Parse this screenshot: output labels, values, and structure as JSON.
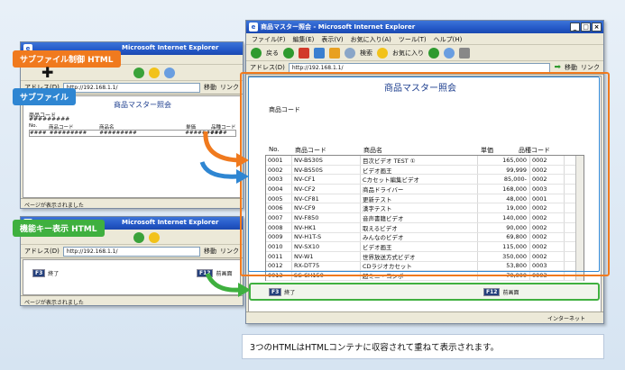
{
  "window": {
    "title": "商品マスター照会 - Microsoft Internet Explorer",
    "menus": [
      "ファイル(F)",
      "編集(E)",
      "表示(V)",
      "お気に入り(A)",
      "ツール(T)",
      "ヘルプ(H)"
    ],
    "toolbar": {
      "back": "戻る",
      "search": "検索",
      "favorites": "お気に入り"
    },
    "address_label": "アドレス(D)",
    "address_value": "http://192.168.1.1/",
    "go_label": "移動",
    "links_label": "リンク",
    "status_zone": "インターネット"
  },
  "page": {
    "heading": "商品マスター照会",
    "field_label": "商品コード",
    "columns": [
      "No.",
      "商品コード",
      "商品名",
      "単価",
      "品種コード"
    ],
    "rows": [
      [
        "0001",
        "NV-BS30S",
        "目次ビデオ TEST ①",
        "165,000",
        "0002"
      ],
      [
        "0002",
        "NV-BS50S",
        "ビデオ画王",
        "99,999",
        "0002"
      ],
      [
        "0003",
        "NV-CF1",
        "Cカセット編集ビデオ",
        "85,000-",
        "0002"
      ],
      [
        "0004",
        "NV-CF2",
        "商品ドライバー",
        "168,000",
        "0003"
      ],
      [
        "0005",
        "NV-CF81",
        "更新テスト",
        "48,000",
        "0001"
      ],
      [
        "0006",
        "NV-CF9",
        "漢字テスト",
        "19,000",
        "0002"
      ],
      [
        "0007",
        "NV-F850",
        "音声書籍ビデオ",
        "140,000",
        "0002"
      ],
      [
        "0008",
        "NV-HK1",
        "取えるビデオ",
        "90,000",
        "0002"
      ],
      [
        "0009",
        "NV-H1T-S",
        "みんなのビデオ",
        "69,800",
        "0002"
      ],
      [
        "0010",
        "NV-SX10",
        "ビデオ画王",
        "115,000",
        "0002"
      ],
      [
        "0011",
        "NV-W1",
        "世界放送方式ビデオ",
        "350,000",
        "0002"
      ],
      [
        "0012",
        "RX-DT75",
        "CDラジオカセット",
        "53,800",
        "0003"
      ],
      [
        "0013",
        "SC-CH150",
        "超ミニ・コンポ",
        "70,000",
        "0003"
      ]
    ]
  },
  "function_keys": [
    {
      "key": "F3",
      "label": "終了"
    },
    {
      "key": "F12",
      "label": "前画面"
    }
  ],
  "callouts": {
    "sub_control": "サブファイル制御 HTML",
    "subfile": "サブファイル",
    "fkey_html": "機能キー表示 HTML"
  },
  "small_windows": {
    "title": "Microsoft Internet Explorer",
    "address_label": "アドレス(D)",
    "address_value": "http://192.168.1.1/",
    "go_label": "移動",
    "links_label": "リンク",
    "status_done": "ページが表示されました",
    "sub_label": "商品コード",
    "sub_value": "#########",
    "sub_cols": [
      "No.",
      "商品コード",
      "商品名",
      "単価",
      "品種コード"
    ],
    "sub_row": [
      "####",
      "#########",
      "#########",
      "#########",
      "####"
    ],
    "heading": "商品マスター照会"
  },
  "caption": "3つのHTMLはHTMLコンテナに収容されて重ねて表示されます。",
  "colors": {
    "accent_orange": "#f07a1e",
    "accent_blue": "#2f86d2",
    "accent_green": "#3fb03f",
    "title_blue": "#2458c7"
  }
}
